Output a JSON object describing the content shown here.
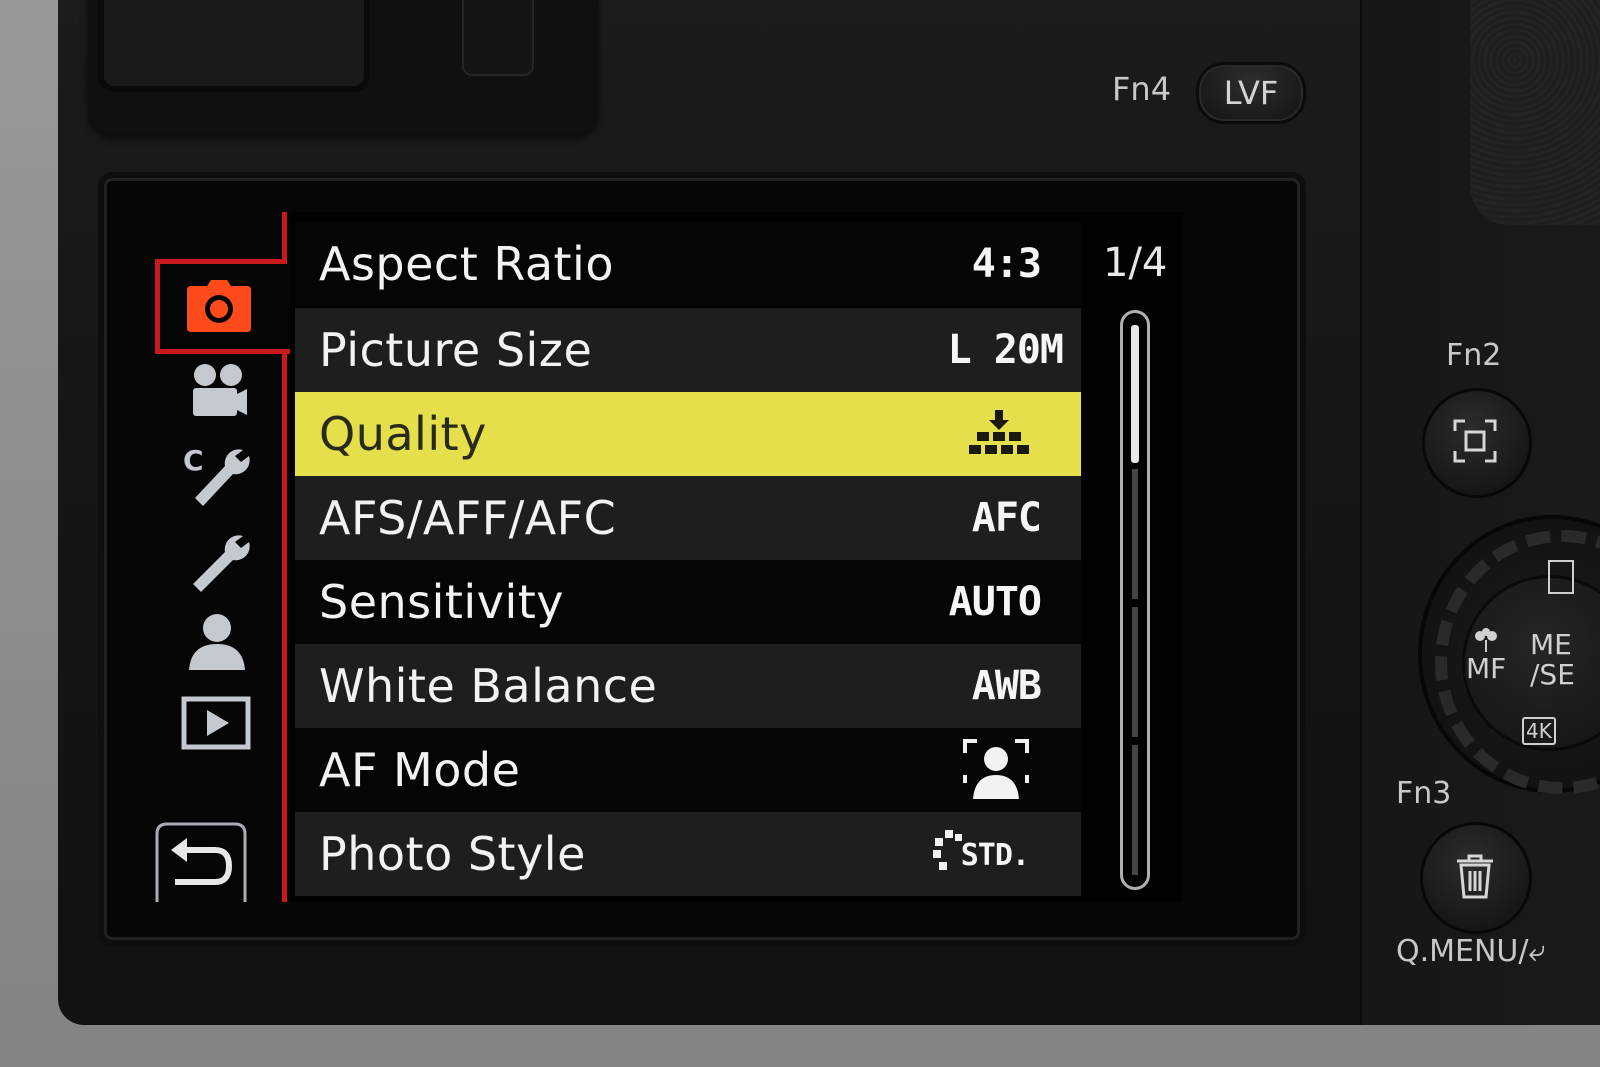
{
  "camera": {
    "fn4_label": "Fn4",
    "lvf_button": "LVF",
    "fn2_label": "Fn2",
    "fn3_label": "Fn3",
    "qmenu_label": "Q.MENU/⤶",
    "dial_mf": "MF",
    "dial_menu": "ME\n/SE",
    "dial_4k": "4K"
  },
  "screen": {
    "page_indicator": "1/4",
    "tabs": [
      {
        "name": "camera-icon",
        "active": true
      },
      {
        "name": "video-icon",
        "active": false
      },
      {
        "name": "custom-wrench-icon",
        "active": false
      },
      {
        "name": "wrench-icon",
        "active": false
      },
      {
        "name": "person-icon",
        "active": false
      },
      {
        "name": "playback-icon",
        "active": false
      },
      {
        "name": "back-icon",
        "active": false
      }
    ],
    "menu_items": [
      {
        "label": "Aspect Ratio",
        "value": "4:3"
      },
      {
        "label": "Picture Size",
        "value": "L 20M"
      },
      {
        "label": "Quality",
        "value": "quality-fine-icon",
        "selected": true
      },
      {
        "label": "AFS/AFF/AFC",
        "value": "AFC"
      },
      {
        "label": "Sensitivity",
        "value": "AUTO"
      },
      {
        "label": "White Balance",
        "value": "AWB"
      },
      {
        "label": "AF Mode",
        "value": "face-detect-icon"
      },
      {
        "label": "Photo Style",
        "value": "STD."
      }
    ],
    "colors": {
      "highlight": "#e4df4a",
      "accent_red": "#c8191c",
      "active_tab_icon": "#ff4a1c"
    }
  }
}
